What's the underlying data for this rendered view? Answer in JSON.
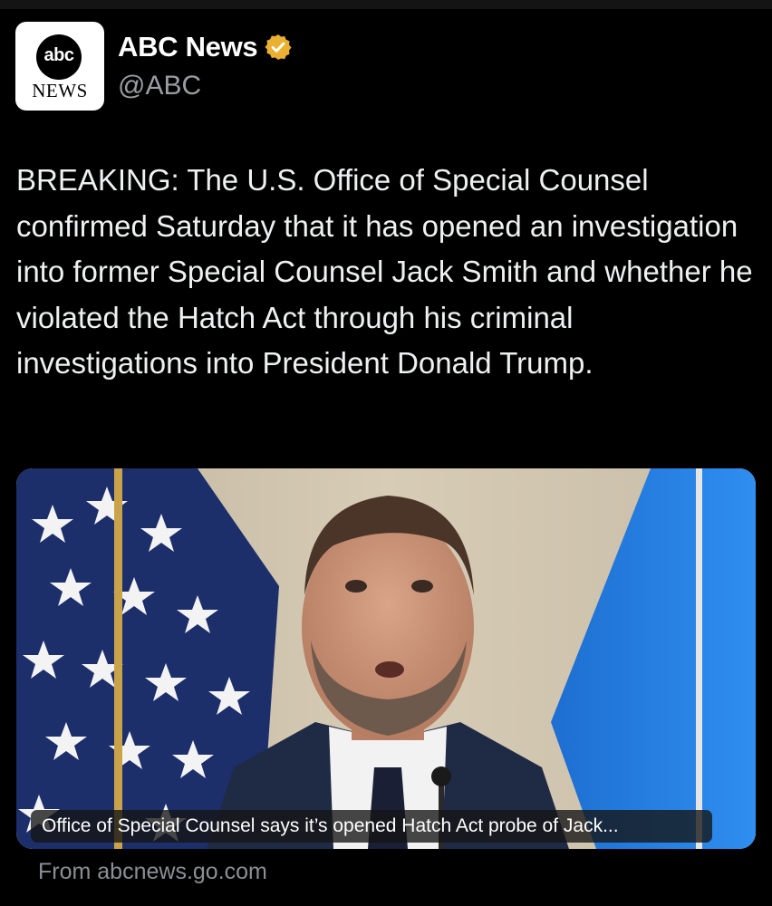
{
  "account": {
    "avatar_logo_text": "abc",
    "avatar_sub_text": "NEWS",
    "display_name": "ABC News",
    "handle": "@ABC",
    "verified_icon": "verified-badge-gold-icon",
    "verified_color": "#e9b032"
  },
  "tweet": {
    "text": "BREAKING: The U.S. Office of Special Counsel confirmed Saturday that it has opened an investigation into former Special Counsel Jack Smith and whether he violated the Hatch Act through his criminal investigations into President Donald Trump."
  },
  "link_card": {
    "headline": "Office of Special Counsel says it’s opened Hatch Act probe of Jack...",
    "source": "From abcnews.go.com"
  },
  "colors": {
    "background": "#000000",
    "text_primary": "#e7e9ea",
    "text_secondary": "#8b8f94"
  }
}
